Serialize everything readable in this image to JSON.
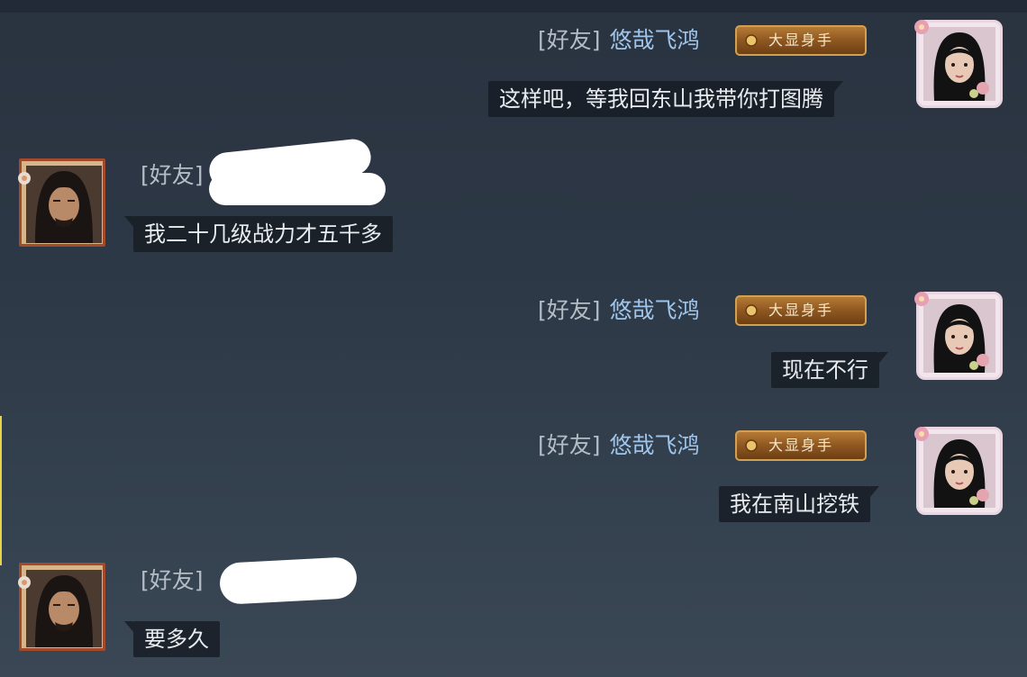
{
  "friend_tag": "[好友]",
  "self_name": "悠哉飞鸿",
  "badge_text": "大显身手",
  "messages": [
    {
      "side": "right",
      "text": "这样吧，等我回东山我带你打图腾"
    },
    {
      "side": "left",
      "text": "我二十几级战力才五千多"
    },
    {
      "side": "right",
      "text": "现在不行"
    },
    {
      "side": "right",
      "text": "我在南山挖铁"
    },
    {
      "side": "left",
      "text": "要多久"
    }
  ],
  "colors": {
    "name_blue": "#9fc4ea",
    "tag_gray": "#b4bcc6",
    "bubble_bg": "#161c23",
    "badge_gold": "#8e5721",
    "redaction": "#ffffff"
  },
  "icons": {
    "self_avatar": "female-portrait-avatar",
    "friend_avatar": "male-portrait-avatar",
    "badge_emblem": "gold-emblem-icon"
  }
}
